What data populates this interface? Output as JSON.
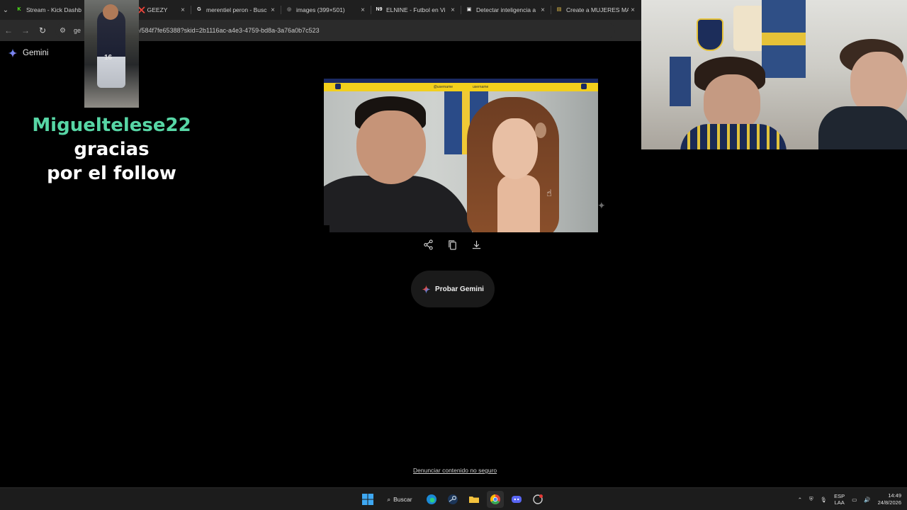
{
  "browser": {
    "tabs": [
      {
        "title": "Stream - Kick Dashb",
        "favicon": "kick-icon",
        "color": "#53fc18",
        "glyph": "K"
      },
      {
        "title": "KRIS R ❌ GEEZY",
        "favicon": "kick-icon",
        "color": "#53fc18",
        "glyph": "K"
      },
      {
        "title": "merentiel peron - Busc",
        "favicon": "google-icon",
        "color": "#ffffff",
        "glyph": "G"
      },
      {
        "title": "images (399×501)",
        "favicon": "globe-icon",
        "color": "#cfcfcf",
        "glyph": "◎"
      },
      {
        "title": "ELNINE - Futbol en Vi",
        "favicon": "elnine-icon",
        "color": "#ffffff",
        "glyph": "N9"
      },
      {
        "title": "Detectar inteligencia a",
        "favicon": "app-icon",
        "color": "#ffffff",
        "glyph": "▣"
      },
      {
        "title": "Create a MUJERES MA",
        "favicon": "page-icon",
        "color": "#f2c94c",
        "glyph": "▤"
      }
    ],
    "url_prefix": "ge",
    "url": "are/584f7fe65388?skid=2b1116ac-a4e3-4759-bd8a-3a76a0b7c523"
  },
  "gemini": {
    "brand": "Gemini",
    "try_label": "Probar Gemini",
    "report_label": "Denunciar contenido no seguro"
  },
  "generated_image": {
    "banner_tiktok": "@username",
    "banner_instagram": "username"
  },
  "alert": {
    "username": "Migueltelese22",
    "message_1": " gracias",
    "message_2": "por el follow"
  },
  "webcam": {
    "small_number": "16"
  },
  "taskbar": {
    "search_label": "Buscar",
    "lang_top": "ESP",
    "lang_bottom": "LAA",
    "time": "14:49",
    "date": "24/8/2026"
  },
  "colors": {
    "alert_username": "#57d6a5",
    "gemini_blue": "#4a8df8",
    "boca_yellow": "#f2cf1c",
    "boca_blue": "#1b2a63"
  }
}
